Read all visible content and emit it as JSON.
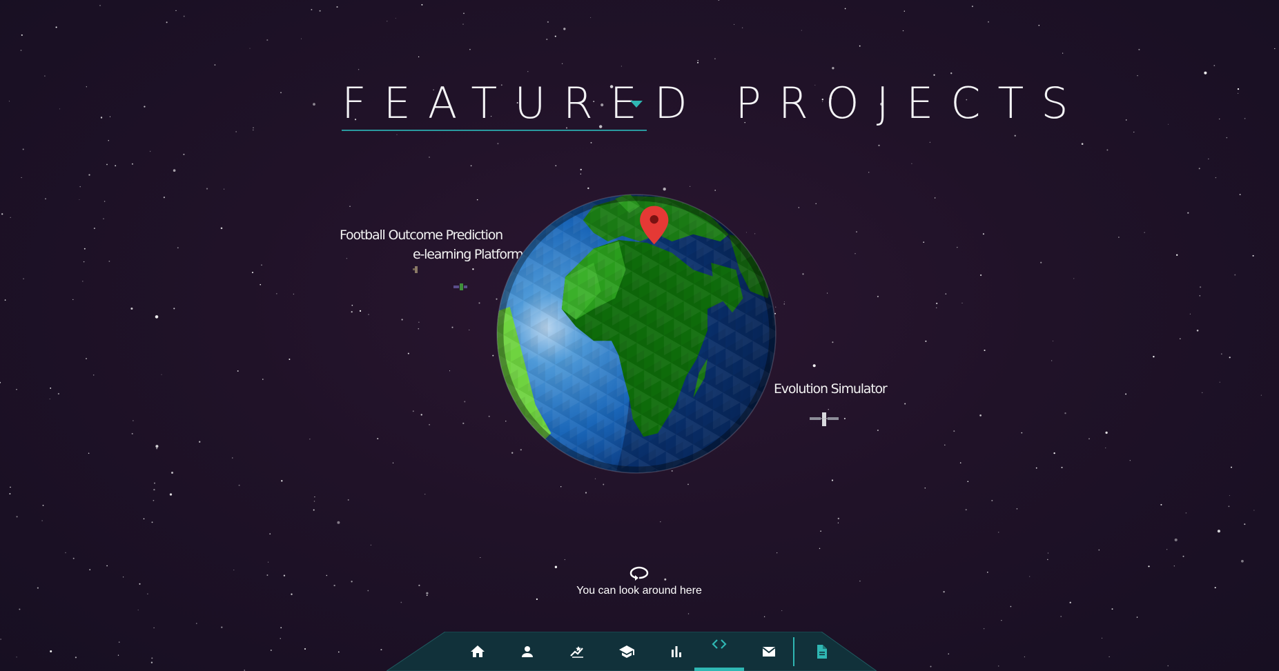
{
  "page": {
    "title": "FEATURED PROJECTS",
    "accent_color": "#2fb7b3",
    "background_color": "#1e1226"
  },
  "globe": {
    "marker": "location-pin-icon",
    "marker_color": "#e53935",
    "ocean_color": "#1565c0",
    "land_color": "#1b7a12"
  },
  "projects": [
    {
      "label": "Football Outcome Prediction",
      "icon": "satellite-icon"
    },
    {
      "label": "e-learning Platform",
      "icon": "satellite-icon"
    },
    {
      "label": "Evolution Simulator",
      "icon": "satellite-icon"
    }
  ],
  "hint": {
    "icon": "rotate-view-icon",
    "text": "You can look around here"
  },
  "nav": {
    "items": [
      {
        "icon": "home-icon",
        "active": false
      },
      {
        "icon": "person-icon",
        "active": false
      },
      {
        "icon": "skills-icon",
        "active": false
      },
      {
        "icon": "graduation-cap-icon",
        "active": false
      },
      {
        "icon": "bar-chart-icon",
        "active": false
      },
      {
        "icon": "code-icon",
        "active": true
      },
      {
        "icon": "mail-icon",
        "active": false
      }
    ],
    "extra": {
      "icon": "document-icon"
    }
  }
}
